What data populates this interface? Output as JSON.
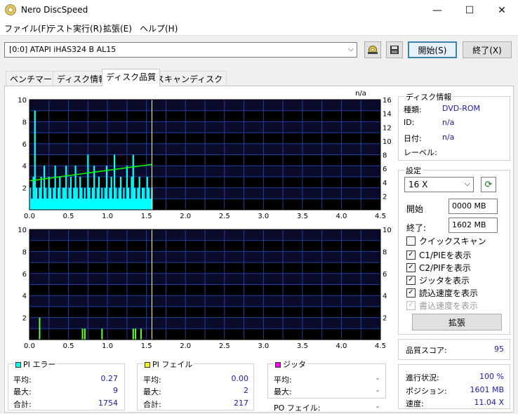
{
  "window": {
    "title": "Nero DiscSpeed",
    "minimize": "—",
    "maximize": "☐",
    "close": "✕"
  },
  "menu": [
    "ファイル(F)",
    "テスト実行(R)",
    "拡張(E)",
    "ヘルプ(H)"
  ],
  "drive": {
    "selected": "[0:0]   ATAPI iHAS324   B AL15"
  },
  "toolbar": {
    "start_label": "開始(S)",
    "stop_label": "終了(X)"
  },
  "tabs": [
    "ベンチマーク",
    "ディスク情報",
    "ディスク品質",
    "スキャンディスク"
  ],
  "active_tab": 2,
  "chart_top_label": "n/a",
  "chart_data": [
    {
      "type": "bar",
      "x_ticks": [
        "0.0",
        "0.5",
        "1.0",
        "1.5",
        "2.0",
        "2.5",
        "3.0",
        "3.5",
        "4.0",
        "4.5"
      ],
      "y_left_ticks": [
        "10",
        "8",
        "6",
        "4",
        "2"
      ],
      "y_right_ticks": [
        "16",
        "14",
        "12",
        "10",
        "8",
        "6",
        "4",
        "2"
      ],
      "xlim": [
        0,
        4.5
      ],
      "ylim_left": [
        0,
        10
      ],
      "ylim_right": [
        0,
        16
      ],
      "marker_x": 1.57,
      "series": [
        {
          "color": "#00ffff",
          "x": [
            0.01,
            0.03,
            0.05,
            0.07,
            0.09,
            0.11,
            0.13,
            0.15,
            0.17,
            0.19,
            0.21,
            0.23,
            0.25,
            0.27,
            0.29,
            0.31,
            0.33,
            0.35,
            0.37,
            0.39,
            0.41,
            0.43,
            0.45,
            0.47,
            0.49,
            0.51,
            0.53,
            0.55,
            0.57,
            0.59,
            0.61,
            0.63,
            0.65,
            0.67,
            0.69,
            0.71,
            0.73,
            0.75,
            0.77,
            0.79,
            0.81,
            0.83,
            0.85,
            0.87,
            0.89,
            0.91,
            0.93,
            0.95,
            0.97,
            0.99,
            1.01,
            1.03,
            1.05,
            1.07,
            1.09,
            1.11,
            1.13,
            1.15,
            1.17,
            1.19,
            1.21,
            1.23,
            1.25,
            1.27,
            1.29,
            1.31,
            1.33,
            1.35,
            1.37,
            1.39,
            1.41,
            1.43,
            1.45,
            1.47,
            1.49,
            1.51,
            1.53,
            1.55,
            1.57
          ],
          "values": [
            2,
            1,
            3,
            9,
            2,
            1,
            2,
            3,
            1,
            4,
            2,
            1,
            3,
            2,
            1,
            2,
            4,
            1,
            2,
            3,
            1,
            2,
            2,
            4,
            1,
            2,
            3,
            1,
            2,
            4,
            2,
            1,
            3,
            2,
            1,
            2,
            1,
            5,
            2,
            1,
            2,
            4,
            1,
            2,
            3,
            1,
            2,
            1,
            2,
            4,
            1,
            2,
            3,
            1,
            5,
            2,
            1,
            2,
            3,
            1,
            2,
            1,
            4,
            2,
            1,
            3,
            5,
            2,
            1,
            2,
            3,
            1,
            2,
            2,
            1,
            3,
            2,
            1,
            2
          ]
        },
        {
          "color": "#00ff00",
          "axis": "right",
          "x": [
            0,
            1.57
          ],
          "values": [
            4.2,
            6.6
          ]
        }
      ]
    },
    {
      "type": "bar",
      "x_ticks": [
        "0.0",
        "0.5",
        "1.0",
        "1.5",
        "2.0",
        "2.5",
        "3.0",
        "3.5",
        "4.0",
        "4.5"
      ],
      "y_left_ticks": [
        "10",
        "8",
        "6",
        "4",
        "2"
      ],
      "y_right_ticks": [
        "10",
        "8",
        "6",
        "4",
        "2"
      ],
      "xlim": [
        0,
        4.5
      ],
      "ylim_left": [
        0,
        10
      ],
      "ylim_right": [
        0,
        10
      ],
      "marker_x": 1.57,
      "series": [
        {
          "color": "#66ff33",
          "x": [
            0.13,
            0.68,
            0.71,
            0.93,
            1.33,
            1.36,
            1.43
          ],
          "values": [
            2,
            1,
            1,
            1,
            1,
            1,
            1
          ]
        }
      ]
    }
  ],
  "disc_info": {
    "title": "ディスク情報",
    "rows": [
      {
        "label": "種類:",
        "value": "DVD-ROM"
      },
      {
        "label": "ID:",
        "value": "n/a"
      },
      {
        "label": "日付:",
        "value": "n/a"
      },
      {
        "label": "レーベル:",
        "value": ""
      }
    ]
  },
  "settings": {
    "title": "設定",
    "speed": "16 X",
    "start_label": "開始",
    "start_value": "0000 MB",
    "end_label": "終了:",
    "end_value": "1602 MB",
    "checks": [
      {
        "label": "クイックスキャン",
        "checked": false,
        "disabled": false
      },
      {
        "label": "C1/PIEを表示",
        "checked": true,
        "disabled": false
      },
      {
        "label": "C2/PIFを表示",
        "checked": true,
        "disabled": false
      },
      {
        "label": "ジッタを表示",
        "checked": true,
        "disabled": false
      },
      {
        "label": "読込速度を表示",
        "checked": true,
        "disabled": false
      },
      {
        "label": "書込速度を表示",
        "checked": true,
        "disabled": true
      }
    ],
    "expand_label": "拡張"
  },
  "quality": {
    "label": "品質スコア:",
    "value": "95"
  },
  "progress": {
    "rows": [
      {
        "label": "進行状況:",
        "value": "100 %"
      },
      {
        "label": "ポジション:",
        "value": "1601 MB"
      },
      {
        "label": "速度:",
        "value": "11.04 X"
      }
    ]
  },
  "pi_errors": {
    "title": "PI エラー",
    "color": "#00ffff",
    "rows": [
      {
        "label": "平均:",
        "value": "0.27"
      },
      {
        "label": "最大:",
        "value": "9"
      },
      {
        "label": "合計:",
        "value": "1754"
      }
    ]
  },
  "pi_fail": {
    "title": "PI フェイル",
    "color": "#ffff00",
    "rows": [
      {
        "label": "平均:",
        "value": "0.00"
      },
      {
        "label": "最大:",
        "value": "2"
      },
      {
        "label": "合計:",
        "value": "217"
      }
    ]
  },
  "jitter": {
    "title": "ジッタ",
    "color": "#ff00ff",
    "rows": [
      {
        "label": "平均:",
        "value": "-"
      },
      {
        "label": "最大:",
        "value": "-"
      }
    ],
    "po_label": "PO フェイル:",
    "po_value": "-"
  }
}
